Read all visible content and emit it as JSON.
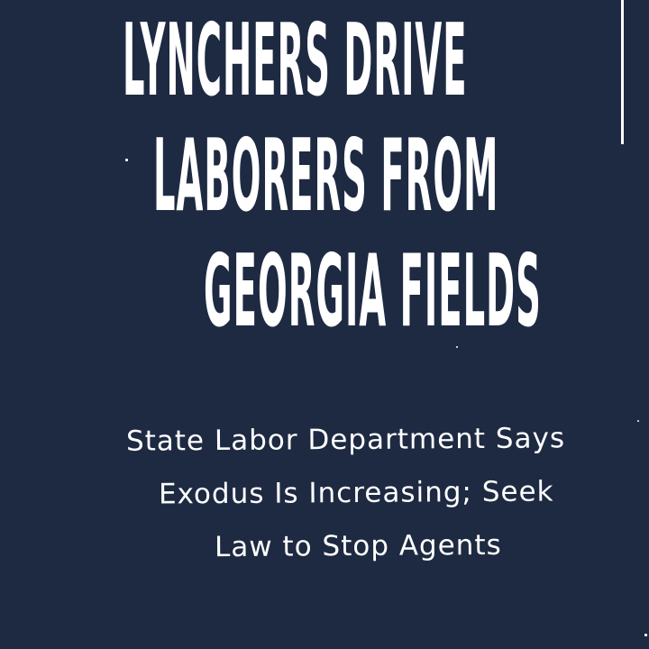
{
  "document": {
    "headline": {
      "line1": "LYNCHERS DRIVE",
      "line2": "LABORERS FROM",
      "line3": "GEORGIA FIELDS"
    },
    "subheadline": {
      "line1": "State Labor Department Says",
      "line2": "Exodus Is Increasing; Seek",
      "line3": "Law to Stop Agents"
    }
  },
  "colors": {
    "background": "#1e2a42",
    "ink": "#ffffff"
  }
}
